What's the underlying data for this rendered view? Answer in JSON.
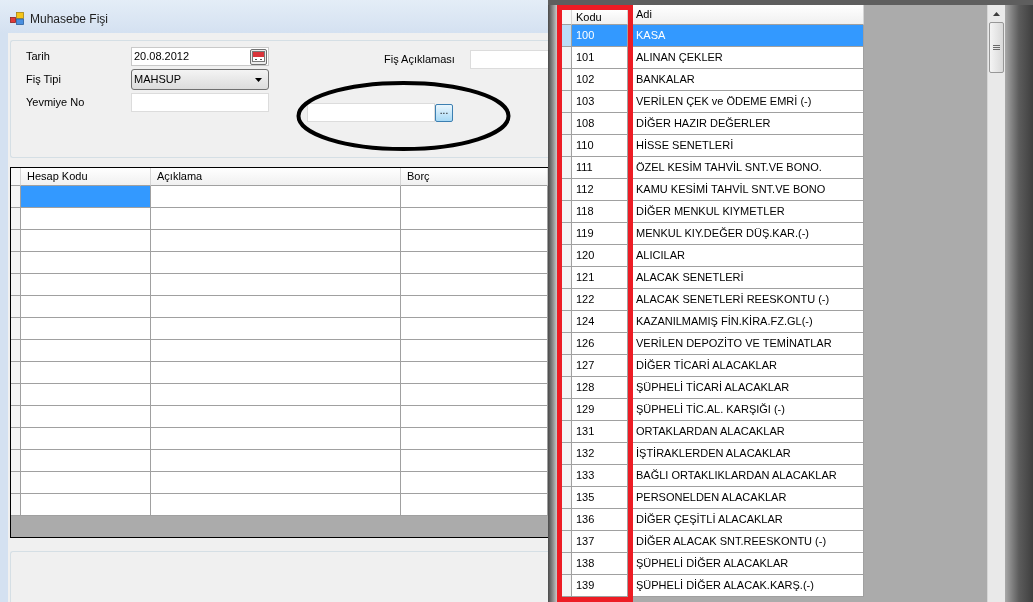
{
  "window": {
    "title": "Muhasebe Fişi"
  },
  "form": {
    "fields": [
      {
        "kind": "date",
        "label": "Tarih",
        "value": "20.08.2012"
      },
      {
        "kind": "select",
        "label": "Fiş Tipi",
        "value": "MAHSUP"
      },
      {
        "kind": "text",
        "label": "Yevmiye No"
      }
    ],
    "description": {
      "label": "Fiş Açıklaması"
    },
    "lookup": {
      "button": "...",
      "circled": true
    }
  },
  "voucher_grid": {
    "columns": [
      "Hesap Kodu",
      "Açıklama",
      "Borç"
    ],
    "rows": [
      {
        "selected": true
      },
      {
        "selected": false
      },
      {
        "selected": false
      },
      {
        "selected": false
      },
      {
        "selected": false
      },
      {
        "selected": false
      },
      {
        "selected": false
      },
      {
        "selected": false
      },
      {
        "selected": false
      },
      {
        "selected": false
      },
      {
        "selected": false
      },
      {
        "selected": false
      },
      {
        "selected": false
      },
      {
        "selected": false
      },
      {
        "selected": false
      }
    ]
  },
  "account_list": {
    "columns": [
      {
        "label": "Kodu",
        "boxed": true
      },
      {
        "label": "Adi",
        "boxed": false
      }
    ],
    "rows": [
      {
        "code": "100",
        "name": "KASA",
        "selected": true
      },
      {
        "code": "101",
        "name": "ALINAN ÇEKLER",
        "selected": false
      },
      {
        "code": "102",
        "name": "BANKALAR",
        "selected": false
      },
      {
        "code": "103",
        "name": "VERİLEN ÇEK ve ÖDEME EMRİ (-)",
        "selected": false
      },
      {
        "code": "108",
        "name": "DİĞER HAZIR DEĞERLER",
        "selected": false
      },
      {
        "code": "110",
        "name": "HİSSE SENETLERİ",
        "selected": false
      },
      {
        "code": "111",
        "name": "ÖZEL KESİM TAHVİL SNT.VE BONO.",
        "selected": false
      },
      {
        "code": "112",
        "name": "KAMU KESİMİ TAHVİL SNT.VE BONO",
        "selected": false
      },
      {
        "code": "118",
        "name": "DİĞER MENKUL KIYMETLER",
        "selected": false
      },
      {
        "code": "119",
        "name": "MENKUL KIY.DEĞER DÜŞ.KAR.(-)",
        "selected": false
      },
      {
        "code": "120",
        "name": "ALICILAR",
        "selected": false
      },
      {
        "code": "121",
        "name": "ALACAK SENETLERİ",
        "selected": false
      },
      {
        "code": "122",
        "name": "ALACAK SENETLERİ REESKONTU (-)",
        "selected": false
      },
      {
        "code": "124",
        "name": "KAZANILMAMIŞ FİN.KİRA.FZ.GL(-)",
        "selected": false
      },
      {
        "code": "126",
        "name": "VERİLEN DEPOZİTO VE TEMİNATLAR",
        "selected": false
      },
      {
        "code": "127",
        "name": "DİĞER TİCARİ ALACAKLAR",
        "selected": false
      },
      {
        "code": "128",
        "name": "ŞÜPHELİ TİCARİ ALACAKLAR",
        "selected": false
      },
      {
        "code": "129",
        "name": "ŞÜPHELİ TİC.AL. KARŞIĞI (-)",
        "selected": false
      },
      {
        "code": "131",
        "name": "ORTAKLARDAN ALACAKLAR",
        "selected": false
      },
      {
        "code": "132",
        "name": "İŞTİRAKLERDEN ALACAKLAR",
        "selected": false
      },
      {
        "code": "133",
        "name": "BAĞLI ORTAKLIKLARDAN ALACAKLAR",
        "selected": false
      },
      {
        "code": "135",
        "name": "PERSONELDEN ALACAKLAR",
        "selected": false
      },
      {
        "code": "136",
        "name": "DİĞER ÇEŞİTLİ ALACAKLAR",
        "selected": false
      },
      {
        "code": "137",
        "name": "DİĞER ALACAK SNT.REESKONTU (-)",
        "selected": false
      },
      {
        "code": "138",
        "name": "ŞÜPHELİ DİĞER ALACAKLAR",
        "selected": false
      },
      {
        "code": "139",
        "name": "ŞÜPHELİ DİĞER ALACAK.KARŞ.(-)",
        "selected": false
      }
    ]
  }
}
